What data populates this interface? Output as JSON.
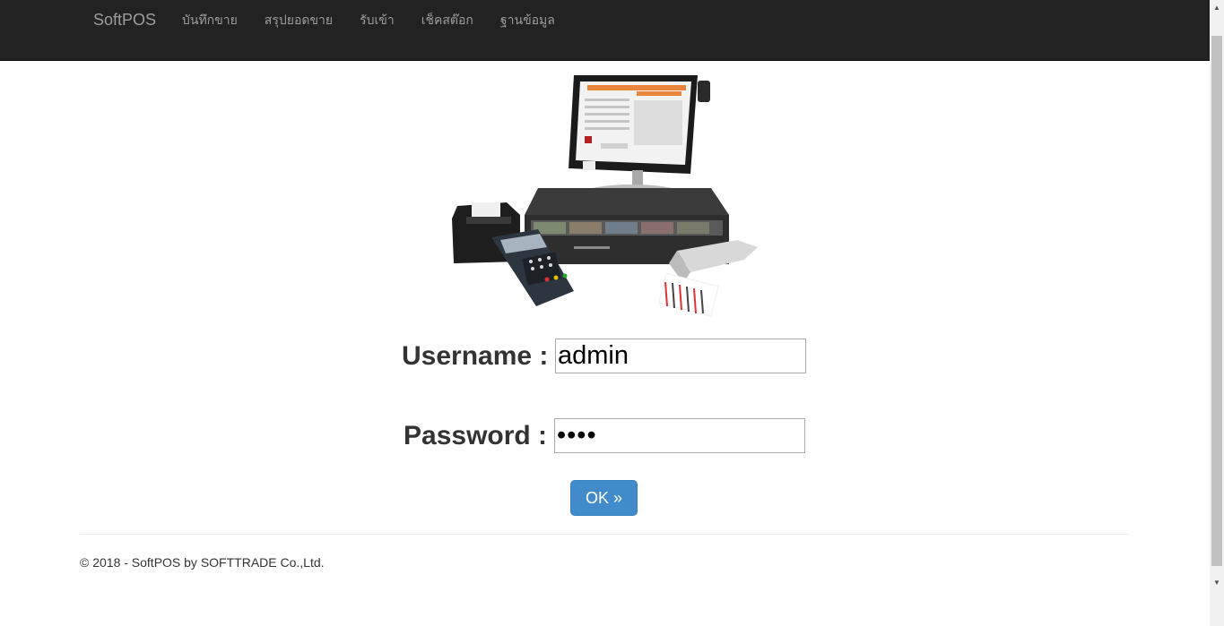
{
  "navbar": {
    "brand": "SoftPOS",
    "items": [
      {
        "label": "บันทึกขาย"
      },
      {
        "label": "สรุปยอดขาย"
      },
      {
        "label": "รับเข้า"
      },
      {
        "label": "เช็คสต๊อก"
      },
      {
        "label": "ฐานข้อมูล"
      }
    ]
  },
  "login": {
    "username_label": "Username :",
    "username_value": "admin",
    "password_label": "Password :",
    "password_value": "1234",
    "ok_label": "OK »"
  },
  "footer": {
    "text": "© 2018 - SoftPOS by SOFTTRADE Co.,Ltd."
  },
  "colors": {
    "navbar_bg": "#222222",
    "nav_text": "#9d9d9d",
    "button_bg": "#428bca",
    "text": "#333333"
  },
  "image": {
    "icon": "pos-terminal-illustration"
  }
}
